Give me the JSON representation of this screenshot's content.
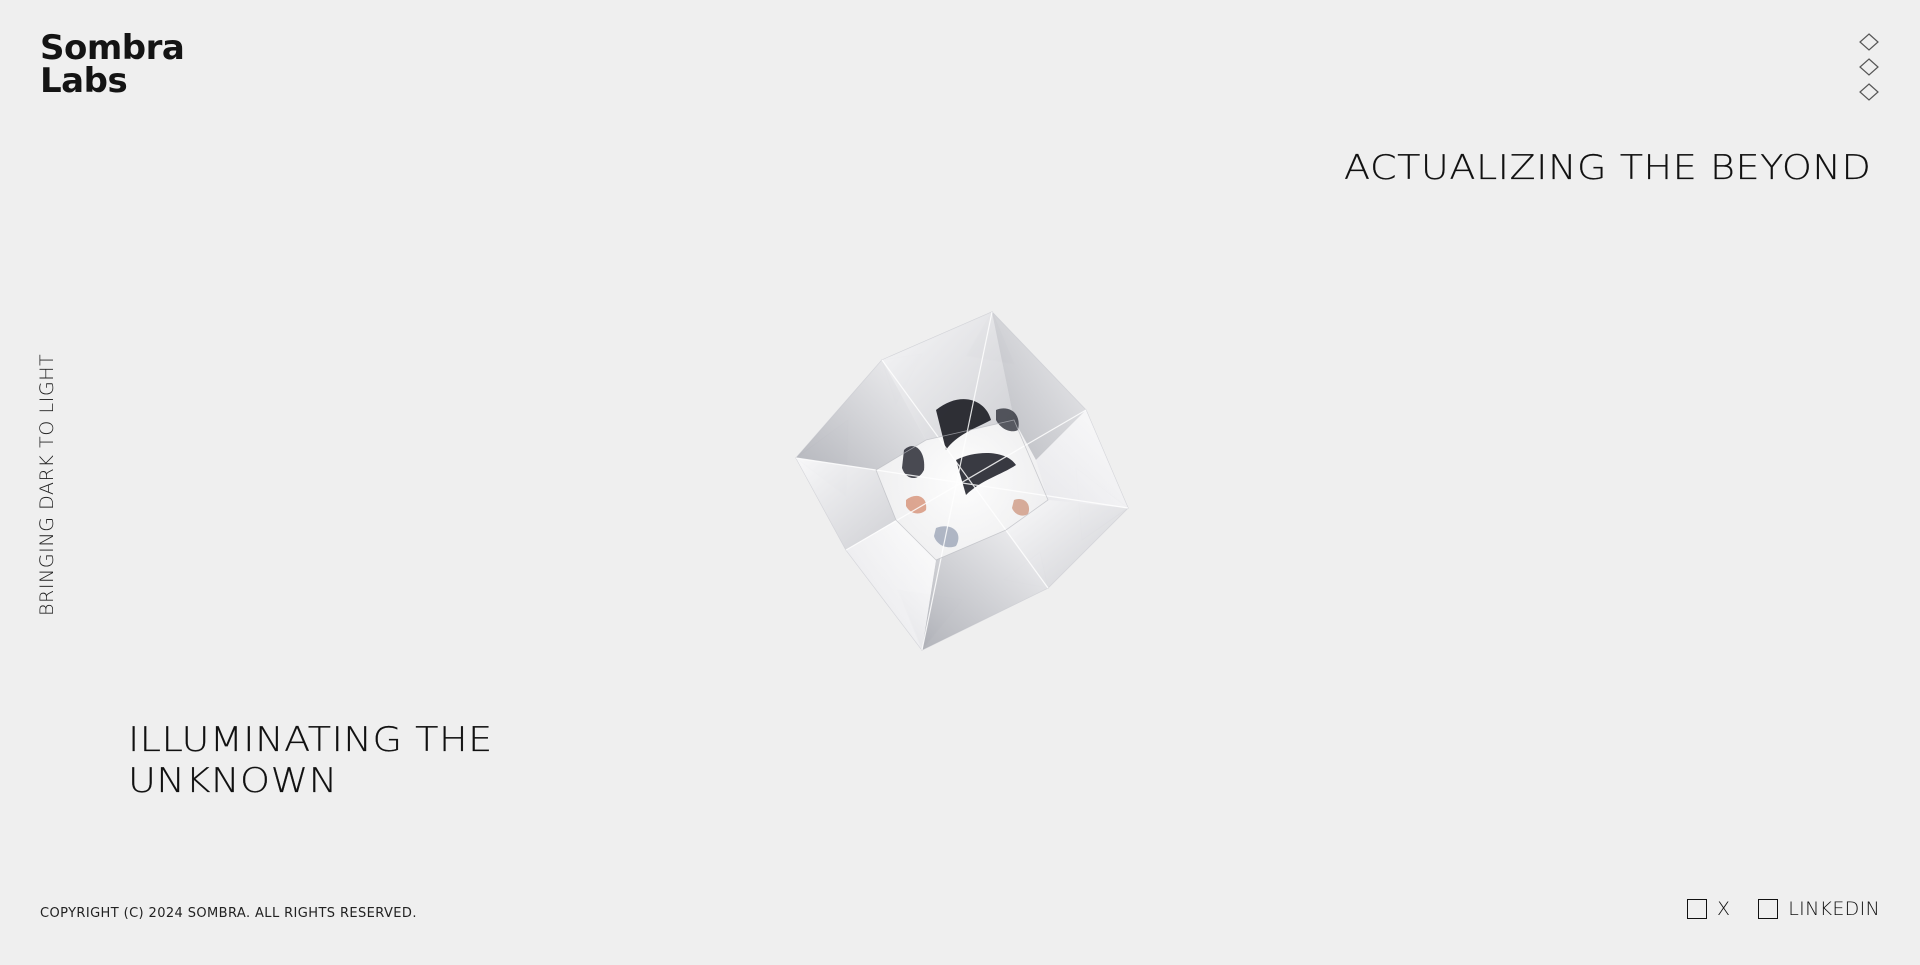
{
  "brand": {
    "line1": "Sombra",
    "line2": "Labs"
  },
  "menu": {
    "icon": "diamond-menu-icon"
  },
  "hero": {
    "headline_top": "ACTUALIZING THE BEYOND",
    "headline_bottom_line1": "ILLUMINATING THE",
    "headline_bottom_line2": "UNKNOWN",
    "tagline": "BRINGING DARK TO LIGHT",
    "visual": "crystal-star-image"
  },
  "footer": {
    "copyright": "COPYRIGHT (C) 2024 SOMBRA. ALL RIGHTS RESERVED.",
    "social": [
      {
        "label": "X",
        "icon": "square-icon"
      },
      {
        "label": "LINKEDIN",
        "icon": "square-icon"
      }
    ]
  },
  "colors": {
    "background": "#efefef",
    "text": "#111111"
  }
}
